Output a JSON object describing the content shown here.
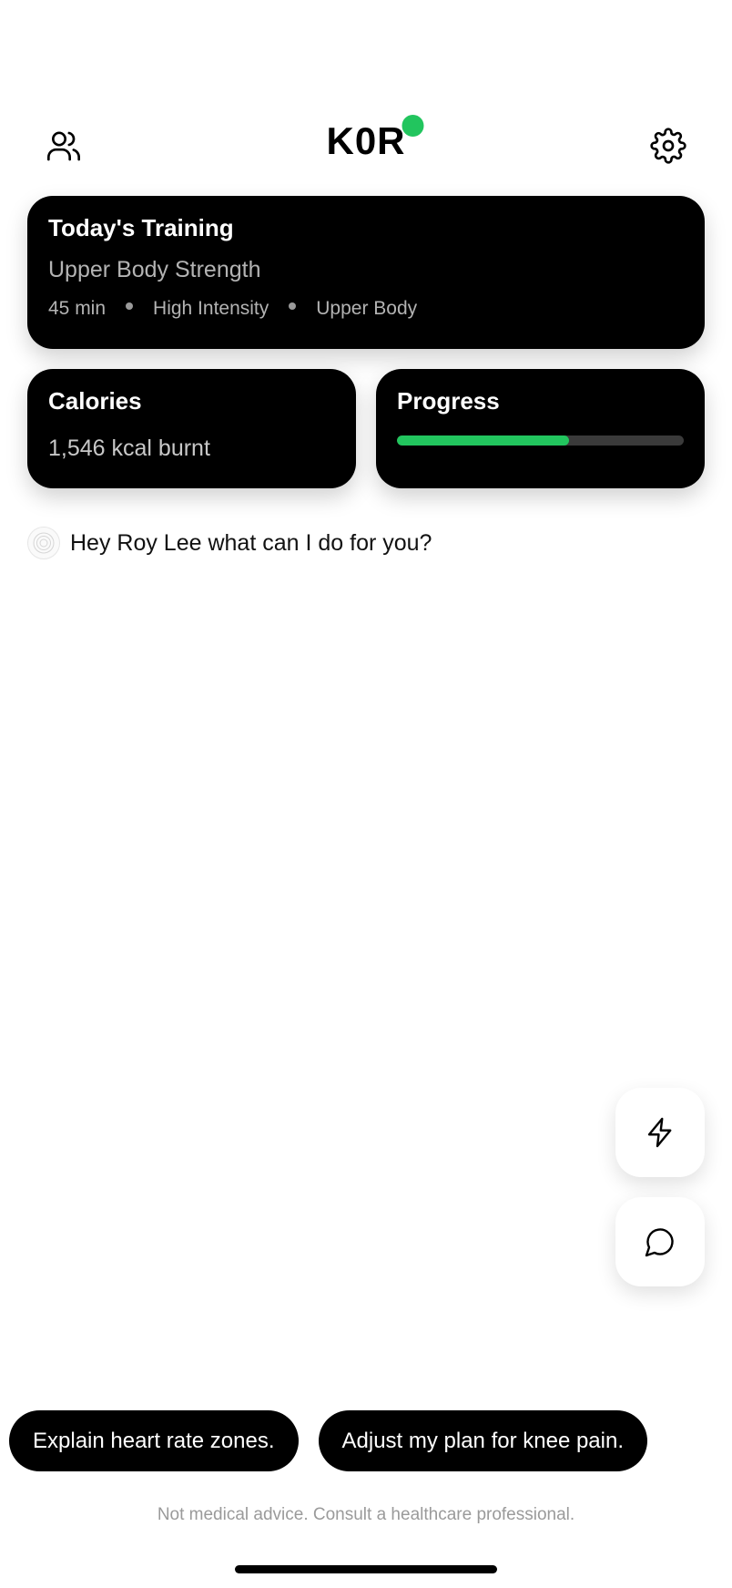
{
  "header": {
    "logo": "K0R",
    "status_color": "#22c55e",
    "left_icon": "users-icon",
    "right_icon": "gear-icon"
  },
  "training": {
    "title": "Today's Training",
    "subtitle": "Upper Body Strength",
    "meta": [
      "45 min",
      "High Intensity",
      "Upper Body"
    ]
  },
  "calories": {
    "title": "Calories",
    "value": "1,546 kcal burnt"
  },
  "progress": {
    "title": "Progress",
    "fraction": 0.6,
    "fill_color": "#22c55e"
  },
  "greeting": {
    "text": "Hey Roy Lee what can I do for you?"
  },
  "fabs": [
    "lightning-icon",
    "chat-bubble-icon"
  ],
  "suggestions": [
    "Explain heart rate zones.",
    "Adjust my plan for knee pain."
  ],
  "disclaimer": "Not medical advice. Consult a healthcare professional."
}
